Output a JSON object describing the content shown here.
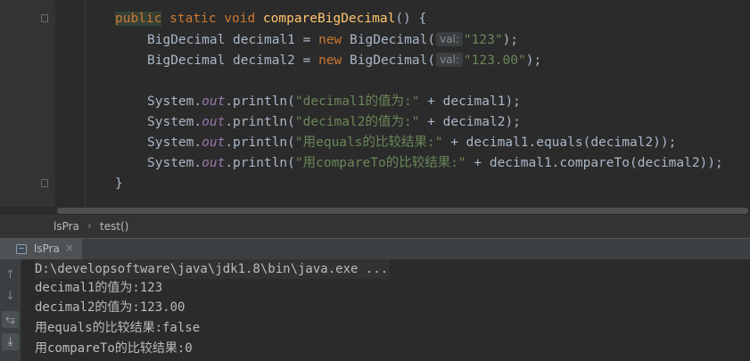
{
  "editor": {
    "line1": {
      "kw_public": "public",
      "kw_static": "static",
      "kw_void": "void",
      "method": "compareBigDecimal",
      "rest": "() {"
    },
    "line2": {
      "type": "BigDecimal",
      "var": "decimal1",
      "eq": "=",
      "kw_new": "new",
      "ctor": "BigDecimal(",
      "hint": "val:",
      "str": "\"123\"",
      "end": ");"
    },
    "line3": {
      "type": "BigDecimal",
      "var": "decimal2",
      "eq": "=",
      "kw_new": "new",
      "ctor": "BigDecimal(",
      "hint": "val:",
      "str": "\"123.00\"",
      "end": ");"
    },
    "line5": {
      "sys": "System.",
      "out": "out",
      "call": ".println(",
      "str": "\"decimal1的值为:\"",
      "rest": " + decimal1);"
    },
    "line6": {
      "sys": "System.",
      "out": "out",
      "call": ".println(",
      "str": "\"decimal2的值为:\"",
      "rest": " + decimal2);"
    },
    "line7": {
      "sys": "System.",
      "out": "out",
      "call": ".println(",
      "str": "\"用equals的比较结果:\"",
      "rest": " + decimal1.equals(decimal2));"
    },
    "line8": {
      "sys": "System.",
      "out": "out",
      "call": ".println(",
      "str": "\"用compareTo的比较结果:\"",
      "rest": " + decimal1.compareTo(decimal2));"
    },
    "line9": {
      "brace": "}"
    }
  },
  "breadcrumb": {
    "class_name": "lsPra",
    "separator": "›",
    "method": "test()"
  },
  "run_panel": {
    "tab_label": "lsPra",
    "tab_close": "×",
    "tools": {
      "up": "↑",
      "down": "↓",
      "wrap": "⥃",
      "scroll_end": "⤓"
    },
    "console_lines": [
      "D:\\developsoftware\\java\\jdk1.8\\bin\\java.exe ...",
      "decimal1的值为:123",
      "decimal2的值为:123.00",
      "用equals的比较结果:false",
      "用compareTo的比较结果:0"
    ]
  },
  "colors": {
    "keyword": "#cc7832",
    "method": "#ffc66d",
    "string": "#6a8759",
    "field": "#9876aa",
    "text": "#a9b7c6",
    "background": "#2b2b2b"
  }
}
